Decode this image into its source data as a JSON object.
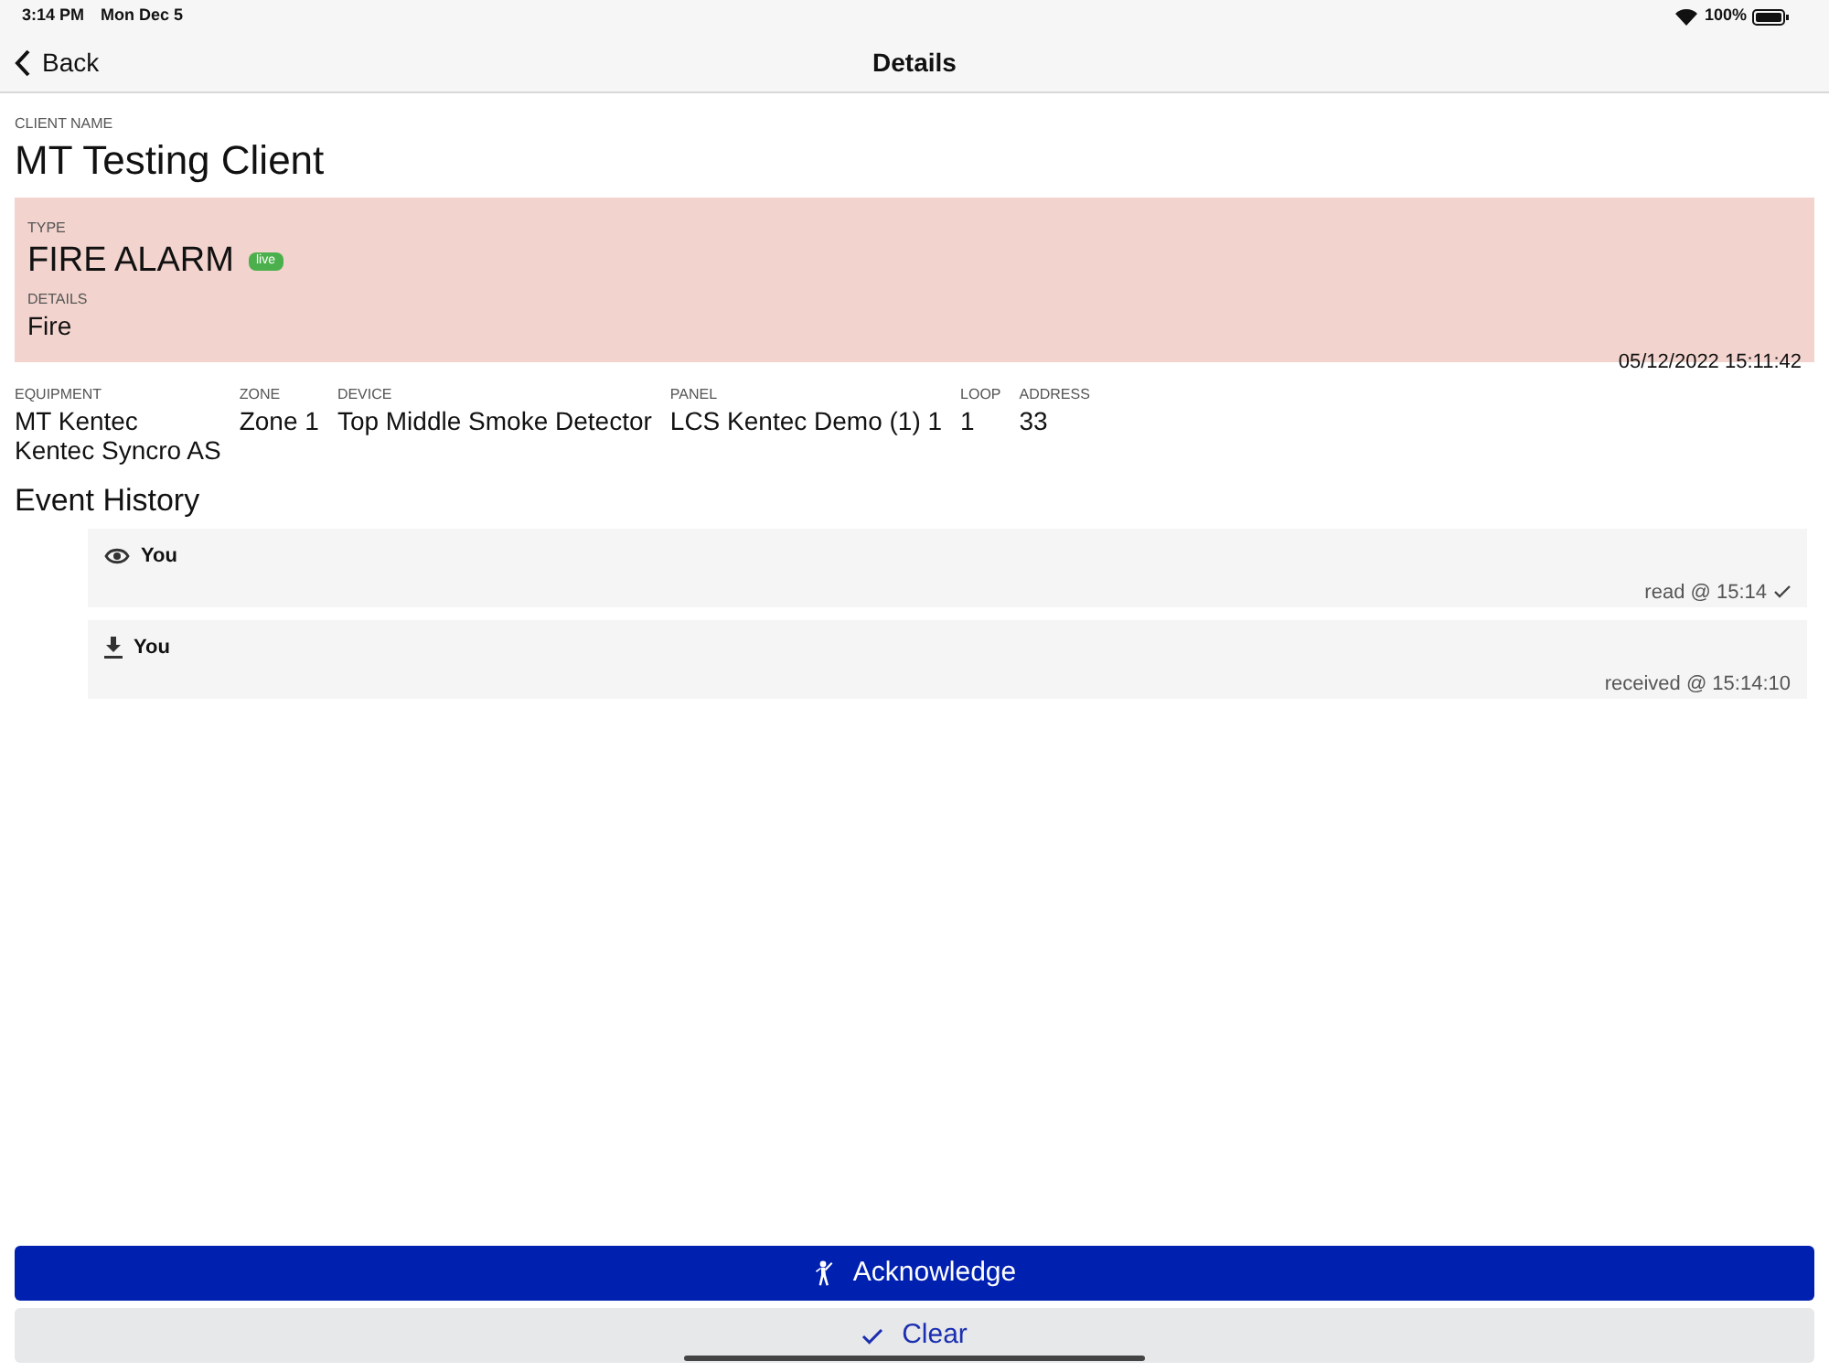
{
  "status_bar": {
    "time": "3:14 PM",
    "date": "Mon Dec 5",
    "battery": "100%"
  },
  "nav": {
    "back": "Back",
    "title": "Details"
  },
  "client": {
    "label": "CLIENT NAME",
    "value": "MT Testing Client"
  },
  "alarm": {
    "type_label": "TYPE",
    "type": "FIRE ALARM",
    "badge": "live",
    "details_label": "DETAILS",
    "details": "Fire",
    "timestamp": "05/12/2022 15:11:42"
  },
  "fields": [
    {
      "label": "EQUIPMENT",
      "lines": [
        "MT Kentec",
        "Kentec Syncro AS"
      ]
    },
    {
      "label": "ZONE",
      "lines": [
        "Zone 1"
      ]
    },
    {
      "label": "DEVICE",
      "lines": [
        "Top Middle Smoke Detector"
      ]
    },
    {
      "label": "PANEL",
      "lines": [
        "LCS Kentec Demo (1) 1"
      ]
    },
    {
      "label": "LOOP",
      "lines": [
        "1"
      ]
    },
    {
      "label": "ADDRESS",
      "lines": [
        "33"
      ]
    }
  ],
  "history": {
    "title": "Event History",
    "events": [
      {
        "kind": "read",
        "user": "You",
        "status": "read @ 15:14",
        "confirmed": true
      },
      {
        "kind": "received",
        "user": "You",
        "status": "received @ 15:14:10",
        "confirmed": false
      }
    ]
  },
  "actions": [
    {
      "kind": "acknowledge",
      "label": "Acknowledge"
    },
    {
      "kind": "clear",
      "label": "Clear"
    }
  ]
}
